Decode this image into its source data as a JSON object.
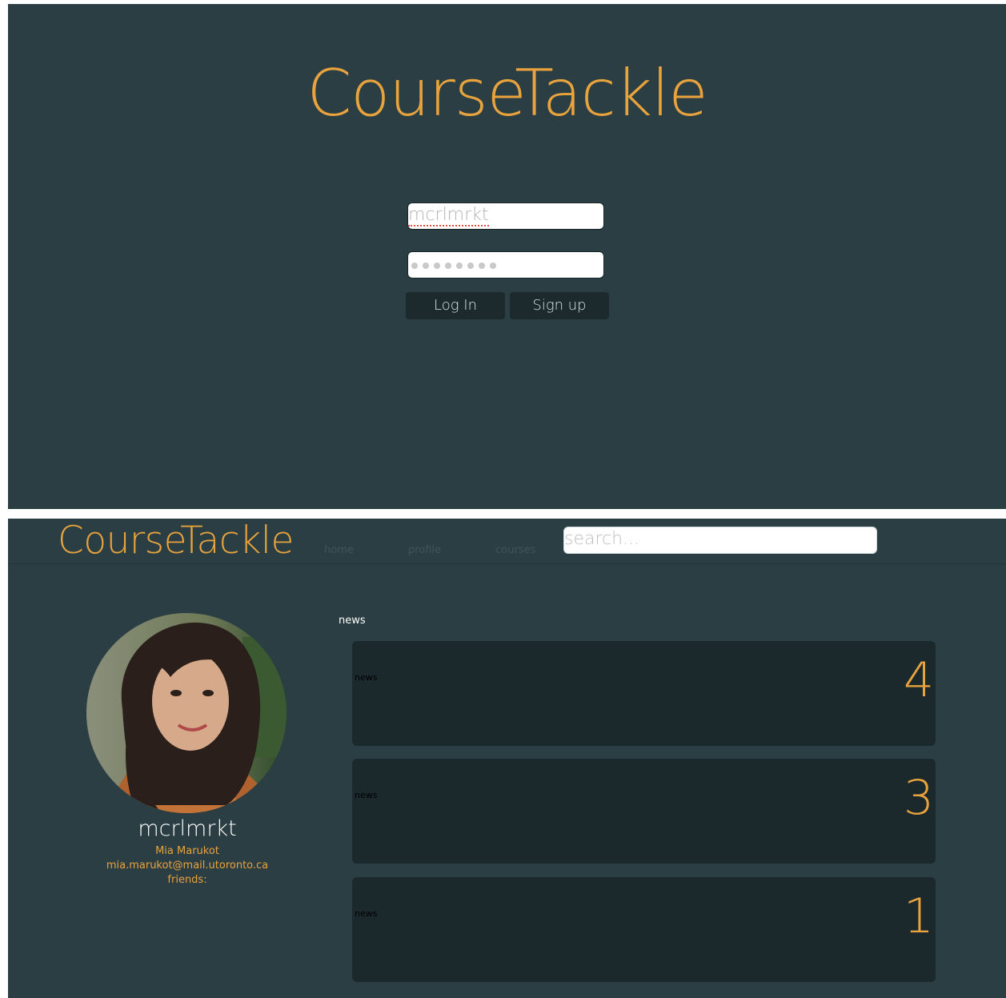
{
  "login": {
    "title": "CourseTackle",
    "username_value": "mcrlmrkt",
    "password_mask": "••••••••",
    "login_label": "Log In",
    "signup_label": "Sign up"
  },
  "header": {
    "brand": "CourseTackle",
    "nav": {
      "home": "home",
      "profile": "profile",
      "courses": "courses"
    },
    "search_placeholder": "search..."
  },
  "profile": {
    "username": "mcrlmrkt",
    "full_name": "Mia Marukot",
    "email": "mia.marukot@mail.utoronto.ca",
    "friends_label": "friends:"
  },
  "news": {
    "heading": "news",
    "items": [
      {
        "label": "news",
        "count": "4"
      },
      {
        "label": "news",
        "count": "3"
      },
      {
        "label": "news",
        "count": "1"
      }
    ]
  },
  "colors": {
    "panel_bg": "#2b3e44",
    "accent": "#e8a33d",
    "card_bg": "#1b282c"
  }
}
